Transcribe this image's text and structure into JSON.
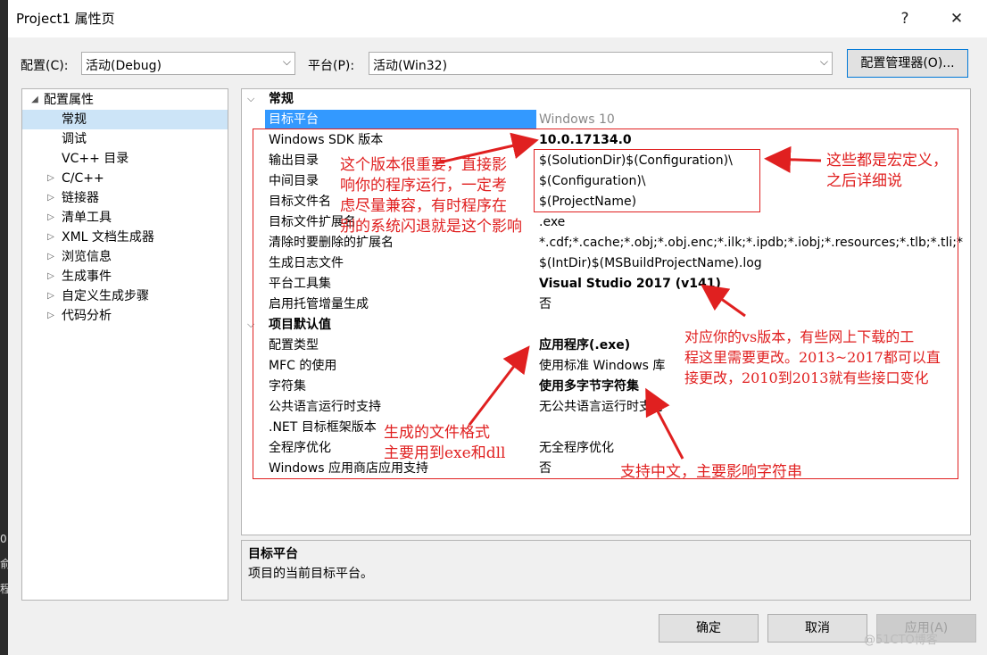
{
  "window": {
    "title": "Project1 属性页",
    "help_label": "?",
    "close_label": "✕"
  },
  "toolbar": {
    "config_label": "配置(C):",
    "config_value": "活动(Debug)",
    "platform_label": "平台(P):",
    "platform_value": "活动(Win32)",
    "config_manager_label": "配置管理器(O)..."
  },
  "tree": {
    "items": [
      {
        "label": "配置属性",
        "expander": "◢"
      },
      {
        "label": "常规"
      },
      {
        "label": "调试"
      },
      {
        "label": "VC++ 目录"
      },
      {
        "label": "C/C++",
        "expander": "▷"
      },
      {
        "label": "链接器",
        "expander": "▷"
      },
      {
        "label": "清单工具",
        "expander": "▷"
      },
      {
        "label": "XML 文档生成器",
        "expander": "▷"
      },
      {
        "label": "浏览信息",
        "expander": "▷"
      },
      {
        "label": "生成事件",
        "expander": "▷"
      },
      {
        "label": "自定义生成步骤",
        "expander": "▷"
      },
      {
        "label": "代码分析",
        "expander": "▷"
      }
    ]
  },
  "grid": {
    "general": {
      "title": "常规",
      "rows": [
        {
          "name": "目标平台",
          "value": "Windows 10"
        },
        {
          "name": "Windows SDK 版本",
          "value": "10.0.17134.0"
        },
        {
          "name": "输出目录",
          "value": "$(SolutionDir)$(Configuration)\\"
        },
        {
          "name": "中间目录",
          "value": "$(Configuration)\\"
        },
        {
          "name": "目标文件名",
          "value": "$(ProjectName)"
        },
        {
          "name": "目标文件扩展名",
          "value": ".exe"
        },
        {
          "name": "清除时要删除的扩展名",
          "value": "*.cdf;*.cache;*.obj;*.obj.enc;*.ilk;*.ipdb;*.iobj;*.resources;*.tlb;*.tli;*"
        },
        {
          "name": "生成日志文件",
          "value": "$(IntDir)$(MSBuildProjectName).log"
        },
        {
          "name": "平台工具集",
          "value": "Visual Studio 2017 (v141)"
        },
        {
          "name": "启用托管增量生成",
          "value": "否"
        }
      ]
    },
    "defaults": {
      "title": "项目默认值",
      "rows": [
        {
          "name": "配置类型",
          "value": "应用程序(.exe)"
        },
        {
          "name": "MFC 的使用",
          "value": "使用标准 Windows 库"
        },
        {
          "name": "字符集",
          "value": "使用多字节字符集"
        },
        {
          "name": "公共语言运行时支持",
          "value": "无公共语言运行时支持"
        },
        {
          "name": ".NET 目标框架版本",
          "value": ""
        },
        {
          "name": "全程序优化",
          "value": "无全程序优化"
        },
        {
          "name": "Windows 应用商店应用支持",
          "value": "否"
        }
      ]
    }
  },
  "description": {
    "title": "目标平台",
    "text": "项目的当前目标平台。"
  },
  "buttons": {
    "ok": "确定",
    "cancel": "取消",
    "apply": "应用(A)"
  },
  "annotations": {
    "sdk_note": [
      "这个版本很重要，直接影",
      "响你的程序运行，一定考",
      "虑尽量兼容，有时程序在",
      "别的系统闪退就是这个影响"
    ],
    "macro_note": [
      "这些都是宏定义，",
      "之后详细说"
    ],
    "toolset_note": [
      "对应你的vs版本，有些网上下载的工",
      "程这里需要更改。2013~2017都可以直",
      "接更改，2010到2013就有些接口变化"
    ],
    "filetype_note": [
      "生成的文件格式",
      "主要用到exe和dll"
    ],
    "charset_note": "支持中文，主要影响字符串"
  },
  "watermark": "@51CTO博客",
  "colors": {
    "annotation": "#e02020",
    "selection": "#3399ff"
  }
}
